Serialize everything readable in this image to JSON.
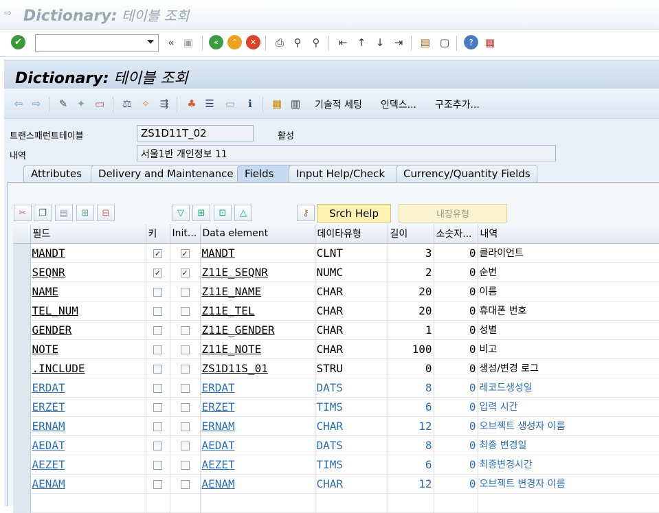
{
  "window": {
    "title_bold": "Dictionary:",
    "title_rest": " 테이블 조회"
  },
  "header": {
    "title_bold": "Dictionary:",
    "title_rest": " 테이블 조회"
  },
  "app_toolbar": {
    "tech_settings": "기술적 세팅",
    "indexes": "인덱스...",
    "append_structure": "구조추가..."
  },
  "form": {
    "transparent_table_label": "트랜스패런트테이블",
    "table_name": "ZS1D11T_02",
    "status": "활성",
    "description_label": "내역",
    "description": "서울1반 개인정보 11"
  },
  "tabs": [
    {
      "label": "Attributes"
    },
    {
      "label": "Delivery and Maintenance"
    },
    {
      "label": "Fields"
    },
    {
      "label": "Input Help/Check"
    },
    {
      "label": "Currency/Quantity Fields"
    }
  ],
  "grid_toolbar": {
    "srch_help": "Srch Help",
    "builtin_type": "내장유형"
  },
  "columns": [
    "필드",
    "키",
    "Init...",
    "Data element",
    "데이타유형",
    "길이",
    "소숫자...",
    "내역"
  ],
  "rows": [
    {
      "field": "MANDT",
      "key": "✓",
      "init": "✓",
      "data_element": "MANDT",
      "type": "CLNT",
      "length": "3",
      "decimals": "0",
      "desc": "클라이언트"
    },
    {
      "field": "SEQNR",
      "key": "✓",
      "init": "✓",
      "data_element": "Z11E_SEQNR",
      "type": "NUMC",
      "length": "2",
      "decimals": "0",
      "desc": "순번"
    },
    {
      "field": "NAME",
      "key": "",
      "init": "",
      "data_element": "Z11E_NAME",
      "type": "CHAR",
      "length": "20",
      "decimals": "0",
      "desc": "이름"
    },
    {
      "field": "TEL_NUM",
      "key": "",
      "init": "",
      "data_element": "Z11E_TEL",
      "type": "CHAR",
      "length": "20",
      "decimals": "0",
      "desc": "휴대폰 번호"
    },
    {
      "field": "GENDER",
      "key": "",
      "init": "",
      "data_element": "Z11E_GENDER",
      "type": "CHAR",
      "length": "1",
      "decimals": "0",
      "desc": "성별"
    },
    {
      "field": "NOTE",
      "key": "",
      "init": "",
      "data_element": "Z11E_NOTE",
      "type": "CHAR",
      "length": "100",
      "decimals": "0",
      "desc": "비고"
    },
    {
      "field": ".INCLUDE",
      "key": "",
      "init": "",
      "data_element": "ZS1D11S_01",
      "type": "STRU",
      "length": "0",
      "decimals": "0",
      "desc": "생성/변경 로그"
    },
    {
      "field": "ERDAT",
      "key": "",
      "init": "",
      "data_element": "ERDAT",
      "type": "DATS",
      "length": "8",
      "decimals": "0",
      "desc": "레코드생성일"
    },
    {
      "field": "ERZET",
      "key": "",
      "init": "",
      "data_element": "ERZET",
      "type": "TIMS",
      "length": "6",
      "decimals": "0",
      "desc": "입력 시간"
    },
    {
      "field": "ERNAM",
      "key": "",
      "init": "",
      "data_element": "ERNAM",
      "type": "CHAR",
      "length": "12",
      "decimals": "0",
      "desc": "오브젝트 생성자 이름"
    },
    {
      "field": "AEDAT",
      "key": "",
      "init": "",
      "data_element": "AEDAT",
      "type": "DATS",
      "length": "8",
      "decimals": "0",
      "desc": "최종 변경일"
    },
    {
      "field": "AEZET",
      "key": "",
      "init": "",
      "data_element": "AEZET",
      "type": "TIMS",
      "length": "6",
      "decimals": "0",
      "desc": "최종변경시간"
    },
    {
      "field": "AENAM",
      "key": "",
      "init": "",
      "data_element": "AENAM",
      "type": "CHAR",
      "length": "12",
      "decimals": "0",
      "desc": "오브젝트 변경자 이름"
    }
  ],
  "included_row_color": "#2a6fb5"
}
